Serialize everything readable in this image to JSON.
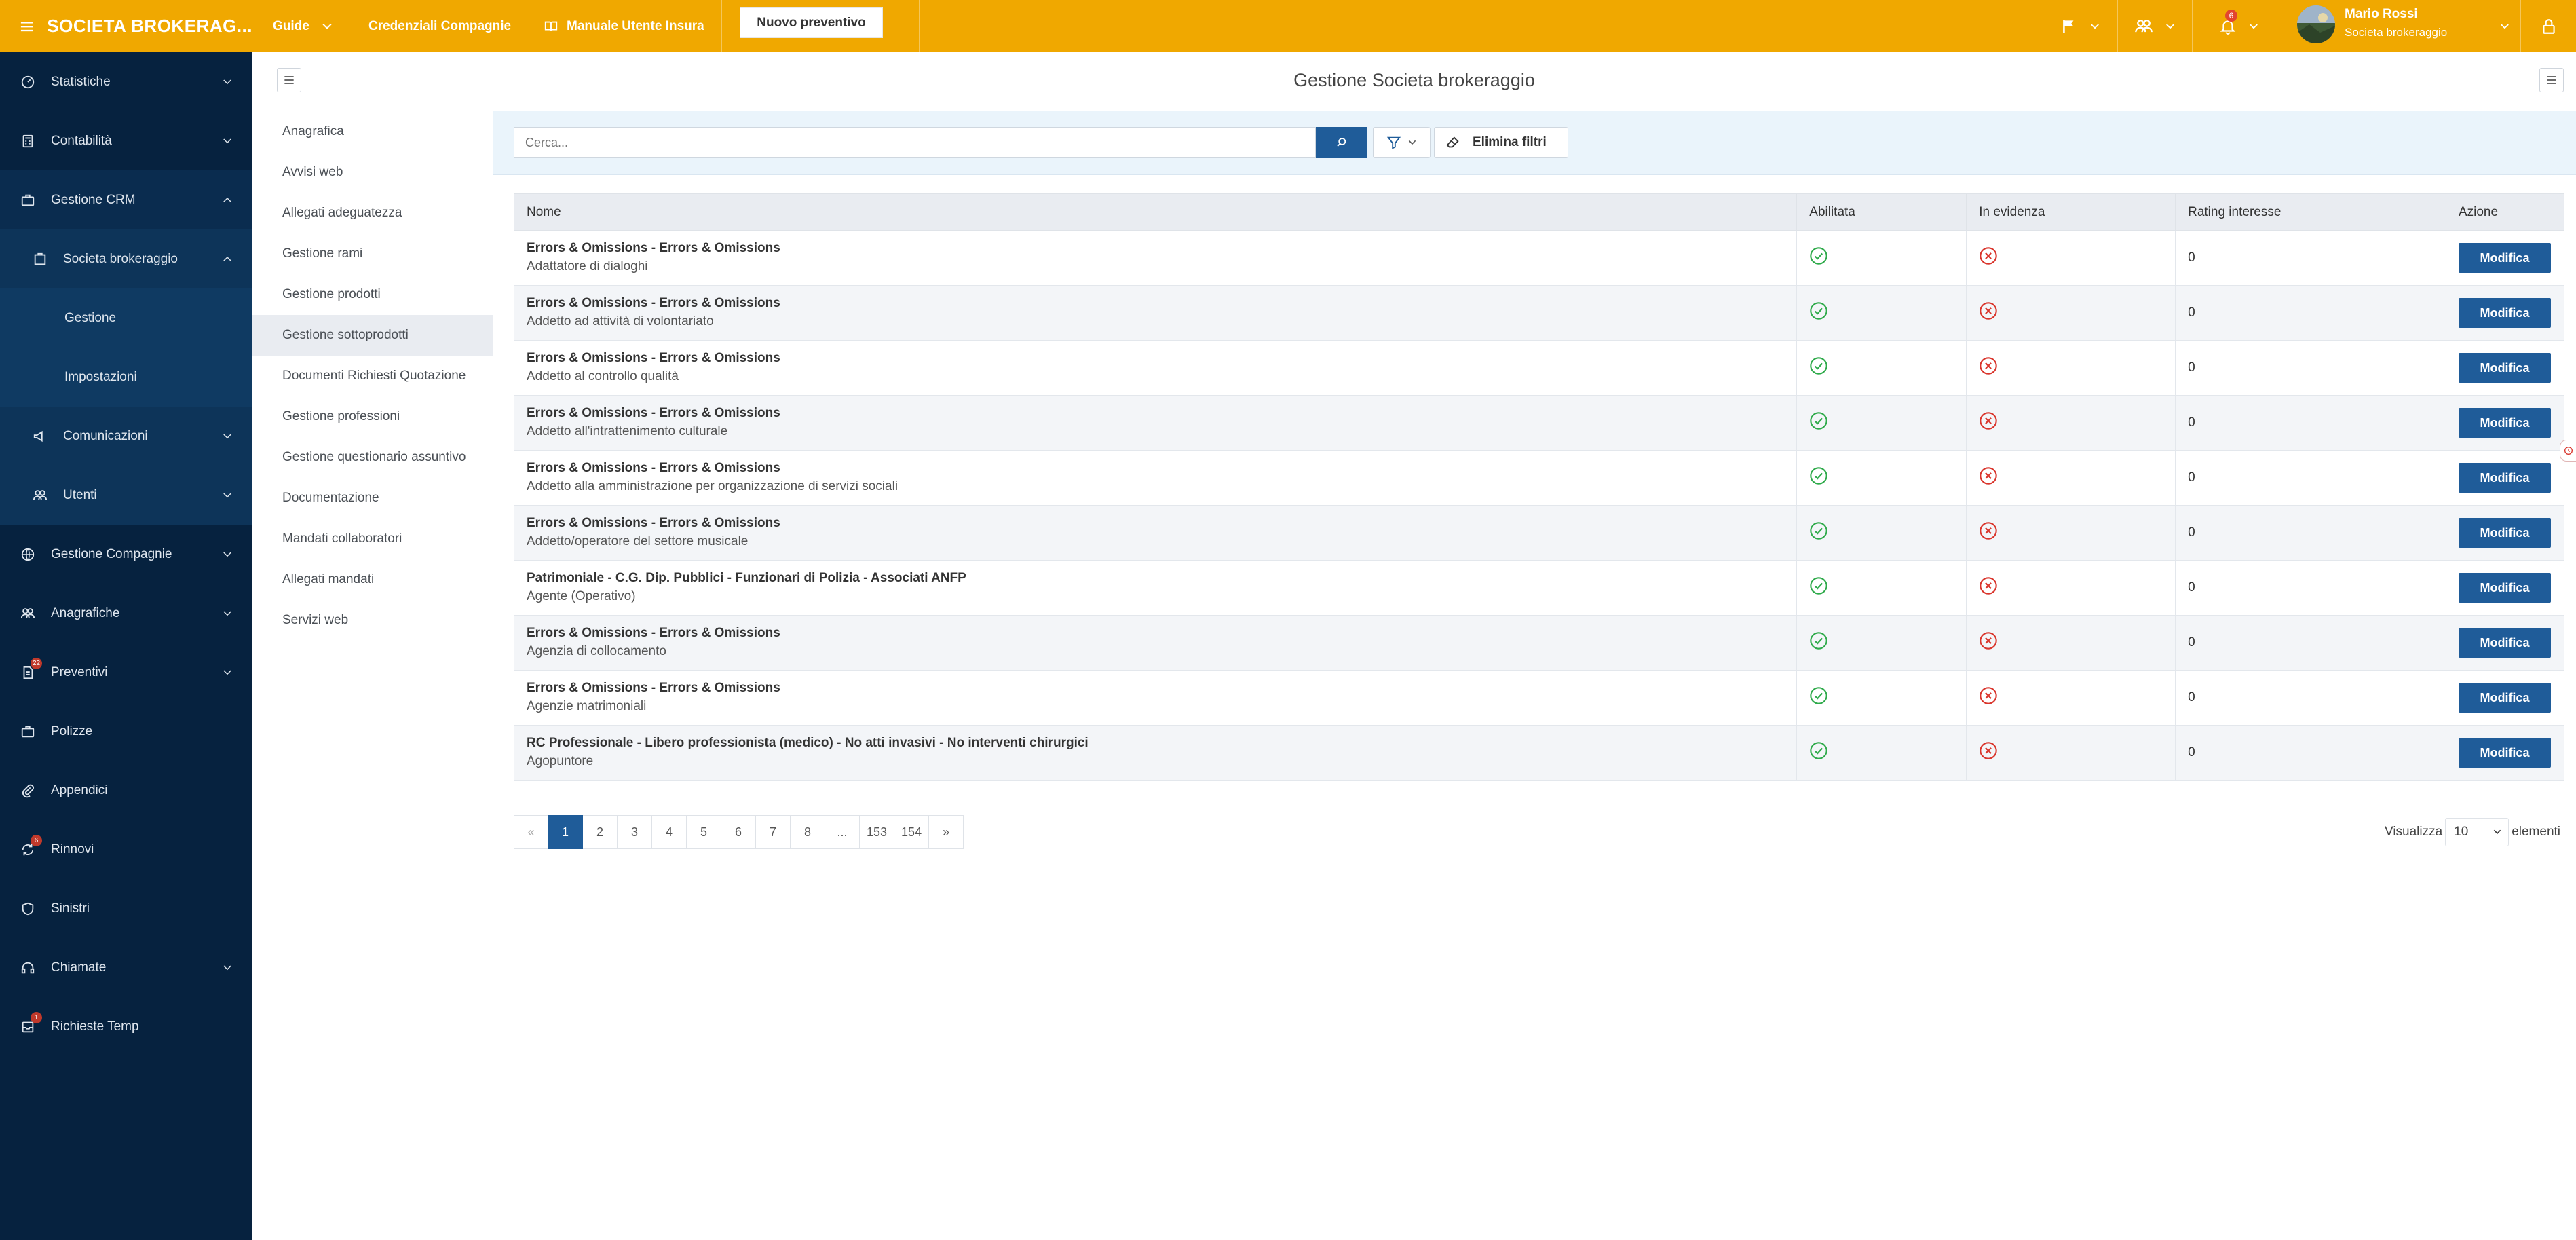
{
  "brand": "SOCIETA BROKERAG...",
  "topnav": {
    "guide": "Guide",
    "credenziali": "Credenziali Compagnie",
    "manuale": "Manuale Utente Insura",
    "nuovo": "Nuovo preventivo",
    "notification_count": "6",
    "user_name": "Mario Rossi",
    "user_role": "Societa brokeraggio"
  },
  "sidebar": {
    "statistiche": "Statistiche",
    "contabilita": "Contabilità",
    "gestione_crm": "Gestione CRM",
    "societa_brokeraggio": "Societa brokeraggio",
    "gestione": "Gestione",
    "impostazioni": "Impostazioni",
    "comunicazioni": "Comunicazioni",
    "utenti": "Utenti",
    "gestione_compagnie": "Gestione Compagnie",
    "anagrafiche": "Anagrafiche",
    "preventivi": "Preventivi",
    "preventivi_badge": "22",
    "polizze": "Polizze",
    "appendici": "Appendici",
    "rinnovi": "Rinnovi",
    "rinnovi_badge": "6",
    "sinistri": "Sinistri",
    "chiamate": "Chiamate",
    "richieste_temp": "Richieste Temp",
    "richieste_badge": "1"
  },
  "page_title": "Gestione Societa brokeraggio",
  "submenu": [
    "Anagrafica",
    "Avvisi web",
    "Allegati adeguatezza",
    "Gestione rami",
    "Gestione prodotti",
    "Gestione sottoprodotti",
    "Documenti Richiesti Quotazione",
    "Gestione professioni",
    "Gestione questionario assuntivo",
    "Documentazione",
    "Mandati collaboratori",
    "Allegati mandati",
    "Servizi web"
  ],
  "search": {
    "placeholder": "Cerca..."
  },
  "clear_filters": "Elimina filtri",
  "table": {
    "headers": {
      "nome": "Nome",
      "abilitata": "Abilitata",
      "evidenza": "In evidenza",
      "rating": "Rating interesse",
      "azione": "Azione"
    },
    "action_label": "Modifica",
    "rows": [
      {
        "title": "Errors & Omissions - Errors & Omissions",
        "subtitle": "Adattatore di dialoghi",
        "enabled": true,
        "featured": false,
        "rating": "0"
      },
      {
        "title": "Errors & Omissions - Errors & Omissions",
        "subtitle": "Addetto ad attività di volontariato",
        "enabled": true,
        "featured": false,
        "rating": "0"
      },
      {
        "title": "Errors & Omissions - Errors & Omissions",
        "subtitle": "Addetto al controllo qualità",
        "enabled": true,
        "featured": false,
        "rating": "0"
      },
      {
        "title": "Errors & Omissions - Errors & Omissions",
        "subtitle": "Addetto all'intrattenimento culturale",
        "enabled": true,
        "featured": false,
        "rating": "0"
      },
      {
        "title": "Errors & Omissions - Errors & Omissions",
        "subtitle": "Addetto alla amministrazione per organizzazione di servizi sociali",
        "enabled": true,
        "featured": false,
        "rating": "0"
      },
      {
        "title": "Errors & Omissions - Errors & Omissions",
        "subtitle": "Addetto/operatore del settore musicale",
        "enabled": true,
        "featured": false,
        "rating": "0"
      },
      {
        "title": "Patrimoniale - C.G. Dip. Pubblici - Funzionari di Polizia - Associati ANFP",
        "subtitle": "Agente (Operativo)",
        "enabled": true,
        "featured": false,
        "rating": "0"
      },
      {
        "title": "Errors & Omissions - Errors & Omissions",
        "subtitle": "Agenzia di collocamento",
        "enabled": true,
        "featured": false,
        "rating": "0"
      },
      {
        "title": "Errors & Omissions - Errors & Omissions",
        "subtitle": "Agenzie matrimoniali",
        "enabled": true,
        "featured": false,
        "rating": "0"
      },
      {
        "title": "RC Professionale - Libero professionista (medico) - No atti invasivi - No interventi chirurgici",
        "subtitle": "Agopuntore",
        "enabled": true,
        "featured": false,
        "rating": "0"
      }
    ]
  },
  "pagination": {
    "pages": [
      "«",
      "1",
      "2",
      "3",
      "4",
      "5",
      "6",
      "7",
      "8",
      "...",
      "153",
      "154",
      "»"
    ],
    "current": "1"
  },
  "page_size": {
    "label_before": "Visualizza",
    "value": "10",
    "label_after": "elementi"
  },
  "colors": {
    "topbar": "#f0a800",
    "sidebar": "#06223f",
    "primary": "#1f5c99",
    "ok": "#2eaa4a",
    "ko": "#d9342b"
  }
}
